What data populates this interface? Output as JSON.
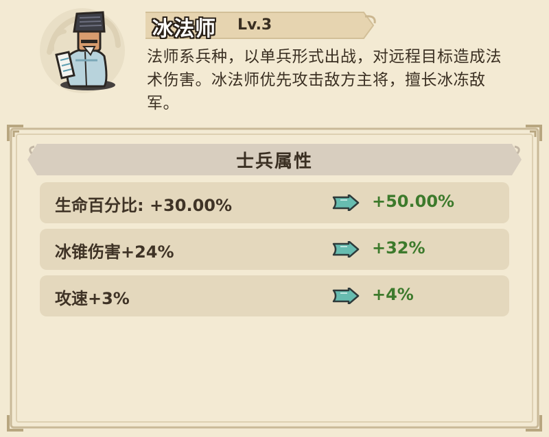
{
  "unit": {
    "name": "冰法师",
    "level": "Lv.3",
    "description": "法师系兵种，以单兵形式出战，对远程目标造成法术伤害。冰法师优先攻击敌方主将，擅长冰冻敌军。",
    "portrait_icon": "ice-mage-portrait"
  },
  "attributes": {
    "title": "士兵属性",
    "rows": [
      {
        "label": "生命百分比: +30.00%",
        "next": "+50.00%",
        "icon": "upgrade-arrow-icon"
      },
      {
        "label": "冰锥伤害+24%",
        "next": "+32%",
        "icon": "upgrade-arrow-icon"
      },
      {
        "label": "攻速+3%",
        "next": "+4%",
        "icon": "upgrade-arrow-icon"
      }
    ]
  },
  "colors": {
    "background": "#f3ead3",
    "row_background": "#e4d8bd",
    "banner": "#e8d8b6",
    "header_bar": "#d6ccbe",
    "value_green": "#3d7a2c",
    "text_dark": "#3a2f22",
    "arrow_teal": "#5bb3a9"
  }
}
